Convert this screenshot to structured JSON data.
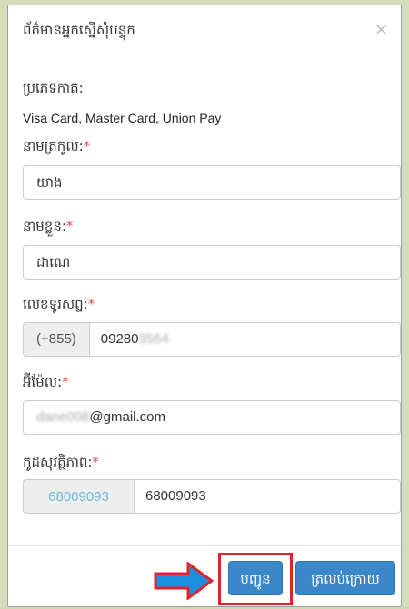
{
  "modal": {
    "title": "ព័ត៌មានអ្នកស្នើសុំបន្ទុក",
    "close_symbol": "×"
  },
  "card_type": {
    "label": "ប្រភេទកាត:",
    "value": "Visa Card, Master Card, Union Pay"
  },
  "last_name": {
    "label": "នាមត្រកូល:",
    "required": "*",
    "value": "យាង"
  },
  "first_name": {
    "label": "នាមខ្លួន:",
    "required": "*",
    "value": "ដាណេ"
  },
  "phone": {
    "label": "លេខទូរសព្ទ:",
    "required": "*",
    "prefix": "(+855)",
    "value_visible": "09280",
    "value_blurred": "3564"
  },
  "email": {
    "label": "អ៊ីម៉ែល:",
    "required": "*",
    "value_blurred": "dane008",
    "value_visible": "@gmail.com"
  },
  "security_code": {
    "label": "កូដសុវត្ថិភាព:",
    "required": "*",
    "captcha": "68009093",
    "value": "68009093"
  },
  "buttons": {
    "submit": "បញ្ជូន",
    "back": "ត្រលប់ក្រោយ"
  },
  "colors": {
    "primary": "#3a87c9",
    "highlight": "#e3222b",
    "arrow": "#1e8fe0",
    "required": "#d9534f"
  }
}
